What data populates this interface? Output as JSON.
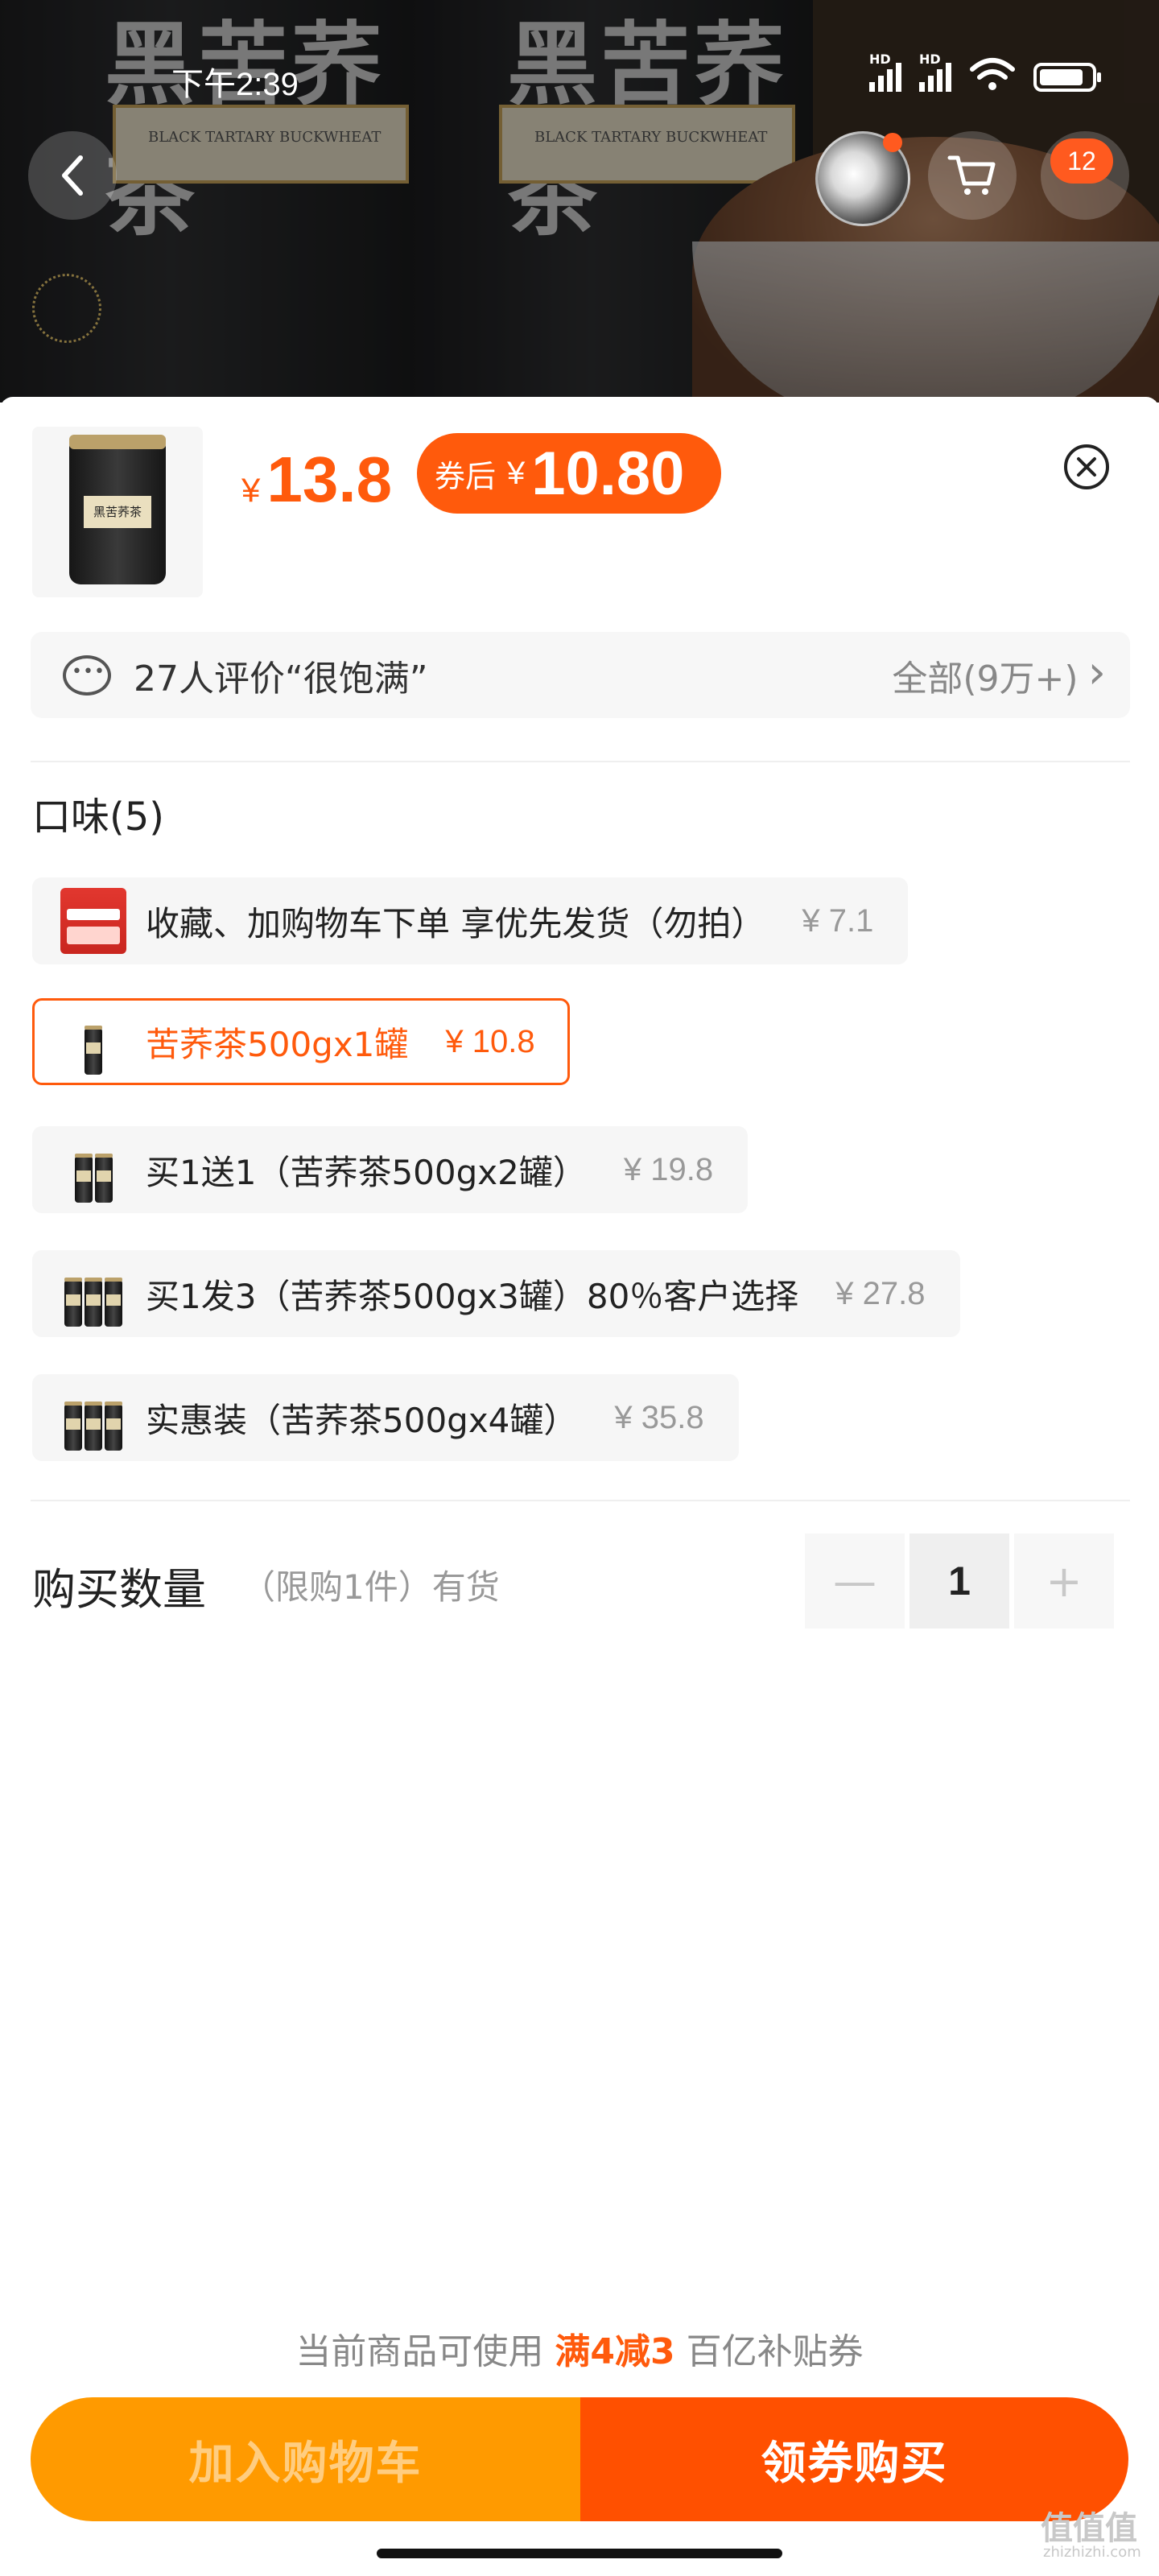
{
  "status_bar": {
    "time": "下午2:39",
    "signal_labels": [
      "HD",
      "HD"
    ],
    "battery_level": 0.85
  },
  "background": {
    "product_text": "黑苦荞茶",
    "label_subtitle": "BLACK TARTARY BUCKWHEAT"
  },
  "nav": {
    "back_icon": "chevron-left-icon",
    "cart_icon": "cart-icon",
    "badge_count": "12"
  },
  "sheet": {
    "thumb_label": "黑苦荞茶",
    "price": {
      "currency": "¥",
      "value": "13.8"
    },
    "coupon_price": {
      "label": "券后",
      "currency": "¥",
      "value": "10.80"
    },
    "close_icon": "close-icon",
    "reviews": {
      "text": "27人评价“很饱满”",
      "all_label": "全部(9万+)",
      "chevron": "›"
    },
    "flavor_title": "口味(5)",
    "options": [
      {
        "text": "收藏、加购物车下单 享优先发货（勿拍）",
        "price": "¥ 7.1",
        "selected": false
      },
      {
        "text": "苦荞茶500gx1罐",
        "price": "¥ 10.8",
        "selected": true
      },
      {
        "text": "买1送1（苦荞茶500gx2罐）",
        "price": "¥ 19.8",
        "selected": false
      },
      {
        "text": "买1发3（苦荞茶500gx3罐）80％客户选择",
        "price": "¥ 27.8",
        "selected": false
      },
      {
        "text": "实惠装（苦荞茶500gx4罐）",
        "price": "¥ 35.8",
        "selected": false
      }
    ],
    "quantity": {
      "label": "购买数量",
      "note": "（限购1件）有货",
      "minus": "—",
      "value": "1",
      "plus": "+"
    },
    "coupon_note": {
      "before": "当前商品可使用",
      "highlight": "满4减3",
      "after": "百亿补贴券"
    },
    "buttons": {
      "add_to_cart": "加入购物车",
      "buy_now": "领券购买"
    }
  },
  "watermark": {
    "text": "值值值",
    "sub": "zhizhizhi.com"
  },
  "colors": {
    "accent": "#ff5a0c",
    "cart_orange": "#ff9a00",
    "buy_orange": "#ff5000"
  }
}
